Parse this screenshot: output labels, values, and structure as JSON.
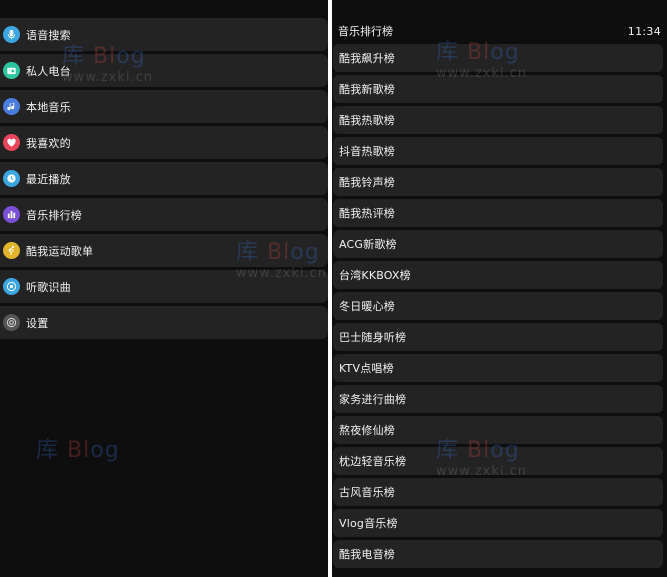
{
  "left_menu": {
    "items": [
      {
        "label": "语音搜索",
        "icon": "microphone-icon",
        "color": "#3ba6e0"
      },
      {
        "label": "私人电台",
        "icon": "radio-icon",
        "color": "#2cc5a0"
      },
      {
        "label": "本地音乐",
        "icon": "music-note-icon",
        "color": "#4a7ce0"
      },
      {
        "label": "我喜欢的",
        "icon": "heart-icon",
        "color": "#e8445a"
      },
      {
        "label": "最近播放",
        "icon": "clock-icon",
        "color": "#3ba6e0"
      },
      {
        "label": "音乐排行榜",
        "icon": "chart-bars-icon",
        "color": "#7b4fd6"
      },
      {
        "label": "酷我运动歌单",
        "icon": "run-icon",
        "color": "#e0b52c"
      },
      {
        "label": "听歌识曲",
        "icon": "recognize-icon",
        "color": "#3ba6e0"
      },
      {
        "label": "设置",
        "icon": "settings-icon",
        "color": "#555555"
      }
    ]
  },
  "right_panel": {
    "title": "音乐排行榜",
    "time": "11:34",
    "rankings": [
      "酷我飙升榜",
      "酷我新歌榜",
      "酷我热歌榜",
      "抖音热歌榜",
      "酷我铃声榜",
      "酷我热评榜",
      "ACG新歌榜",
      "台湾KKBOX榜",
      "冬日暖心榜",
      "巴士随身听榜",
      "KTV点唱榜",
      "家务进行曲榜",
      "熬夜修仙榜",
      "枕边轻音乐榜",
      "古风音乐榜",
      "Vlog音乐榜",
      "酷我电音榜"
    ]
  },
  "watermark": {
    "k": "库",
    "b": "Bl",
    "l": "og",
    "site": "www.zxki.cn"
  }
}
